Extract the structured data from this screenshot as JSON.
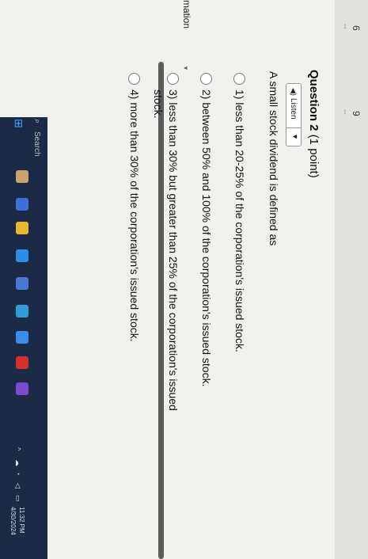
{
  "nav": {
    "items": [
      "6",
      "9"
    ]
  },
  "sidebar": {
    "label": "mation"
  },
  "question": {
    "title": "Question 2",
    "points": "(1 point)",
    "listen_label": "Listen",
    "prompt": "A small stock dividend is defined as",
    "options": [
      {
        "label": "1) less than 20-25% of the corporation's issued stock."
      },
      {
        "label": "2) between 50% and 100% of the corporation's issued stock."
      },
      {
        "label": "3) less than 30% but greater than 25% of the corporation's issued",
        "label2": "stock."
      },
      {
        "label": "4) more than 30% of the corporation's issued stock."
      }
    ]
  },
  "taskbar": {
    "search_placeholder": "Search",
    "time": "11:32 PM",
    "date": "4/30/2024",
    "colors": {
      "background": "#1b2a47",
      "accent": "#3aa0ff"
    }
  }
}
